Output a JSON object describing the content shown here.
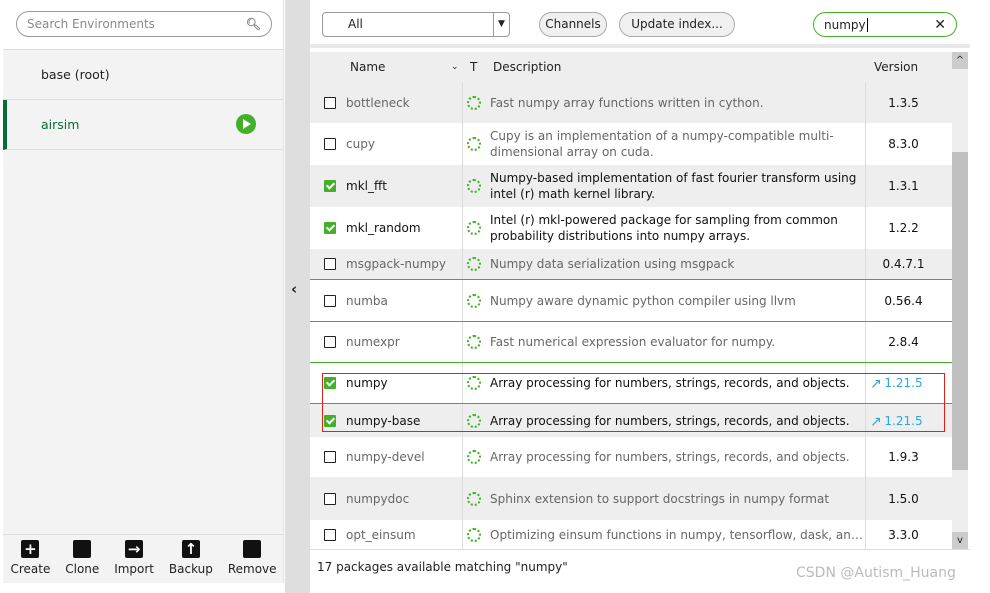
{
  "environments": {
    "search_placeholder": "Search Environments",
    "items": [
      {
        "name": "base (root)",
        "active": false
      },
      {
        "name": "airsim",
        "active": true
      }
    ],
    "actions": [
      {
        "label": "Create",
        "icon": "plus-box-icon"
      },
      {
        "label": "Clone",
        "icon": "clone-icon"
      },
      {
        "label": "Import",
        "icon": "import-icon"
      },
      {
        "label": "Backup",
        "icon": "upload-icon"
      },
      {
        "label": "Remove",
        "icon": "trash-icon"
      }
    ]
  },
  "toolbar": {
    "filter": "All",
    "channels": "Channels",
    "update_index": "Update index...",
    "search_value": "numpy"
  },
  "table": {
    "headers": {
      "name": "Name",
      "type": "T",
      "description": "Description",
      "version": "Version"
    },
    "rows": [
      {
        "name": "bottleneck",
        "description": "Fast numpy array functions written in cython.",
        "version": "1.3.5",
        "installed": false,
        "update": false
      },
      {
        "name": "cupy",
        "description": "Cupy is an implementation of a numpy-compatible multi-dimensional array on cuda.",
        "version": "8.3.0",
        "installed": false,
        "update": false
      },
      {
        "name": "mkl_fft",
        "description": "Numpy-based implementation of fast fourier transform using intel (r) math kernel library.",
        "version": "1.3.1",
        "installed": true,
        "update": false
      },
      {
        "name": "mkl_random",
        "description": "Intel (r) mkl-powered package for sampling from common probability distributions into numpy arrays.",
        "version": "1.2.2",
        "installed": true,
        "update": false
      },
      {
        "name": "msgpack-numpy",
        "description": "Numpy data serialization using msgpack",
        "version": "0.4.7.1",
        "installed": false,
        "update": false
      },
      {
        "name": "numba",
        "description": "Numpy aware dynamic python compiler using llvm",
        "version": "0.56.4",
        "installed": false,
        "update": false
      },
      {
        "name": "numexpr",
        "description": "Fast numerical expression evaluator for numpy.",
        "version": "2.8.4",
        "installed": false,
        "update": false
      },
      {
        "name": "numpy",
        "description": "Array processing for numbers, strings, records, and objects.",
        "version": "1.21.5",
        "installed": true,
        "update": true
      },
      {
        "name": "numpy-base",
        "description": "Array processing for numbers, strings, records, and objects.",
        "version": "1.21.5",
        "installed": true,
        "update": true
      },
      {
        "name": "numpy-devel",
        "description": "Array processing for numbers, strings, records, and objects.",
        "version": "1.9.3",
        "installed": false,
        "update": false
      },
      {
        "name": "numpydoc",
        "description": "Sphinx extension to support docstrings in numpy format",
        "version": "1.5.0",
        "installed": false,
        "update": false
      },
      {
        "name": "opt_einsum",
        "description": "Optimizing einsum functions in numpy, tensorflow, dask, and more with optimized contraction order.",
        "version": "3.3.0",
        "installed": false,
        "update": false
      }
    ]
  },
  "status": "17 packages available matching \"numpy\"",
  "watermark": "CSDN @Autism_Huang",
  "colors": {
    "accent": "#43b02a",
    "active_env": "#0b6b3a",
    "update": "#29a8e0",
    "highlight": "#e02020"
  }
}
